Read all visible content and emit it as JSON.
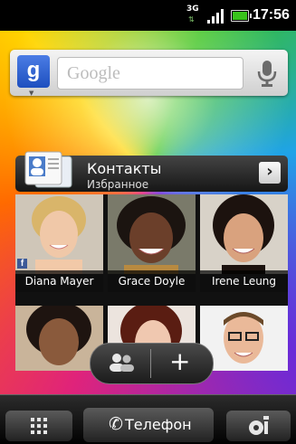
{
  "statusbar": {
    "network": "3G",
    "time": "17:56",
    "battery_level": 0.9
  },
  "search": {
    "placeholder": "Google",
    "engine_letter": "g"
  },
  "contacts_widget": {
    "title": "Контакты",
    "subtitle": "Избранное",
    "favorites": [
      {
        "name": "Diana Mayer",
        "facebook": true
      },
      {
        "name": "Grace Doyle"
      },
      {
        "name": "Irene Leung"
      }
    ]
  },
  "dock": {
    "phone_label": "Телефон"
  },
  "colors": {
    "accent_blue": "#1e4fbf",
    "battery": "#38c21b",
    "facebook": "#3b5998"
  }
}
